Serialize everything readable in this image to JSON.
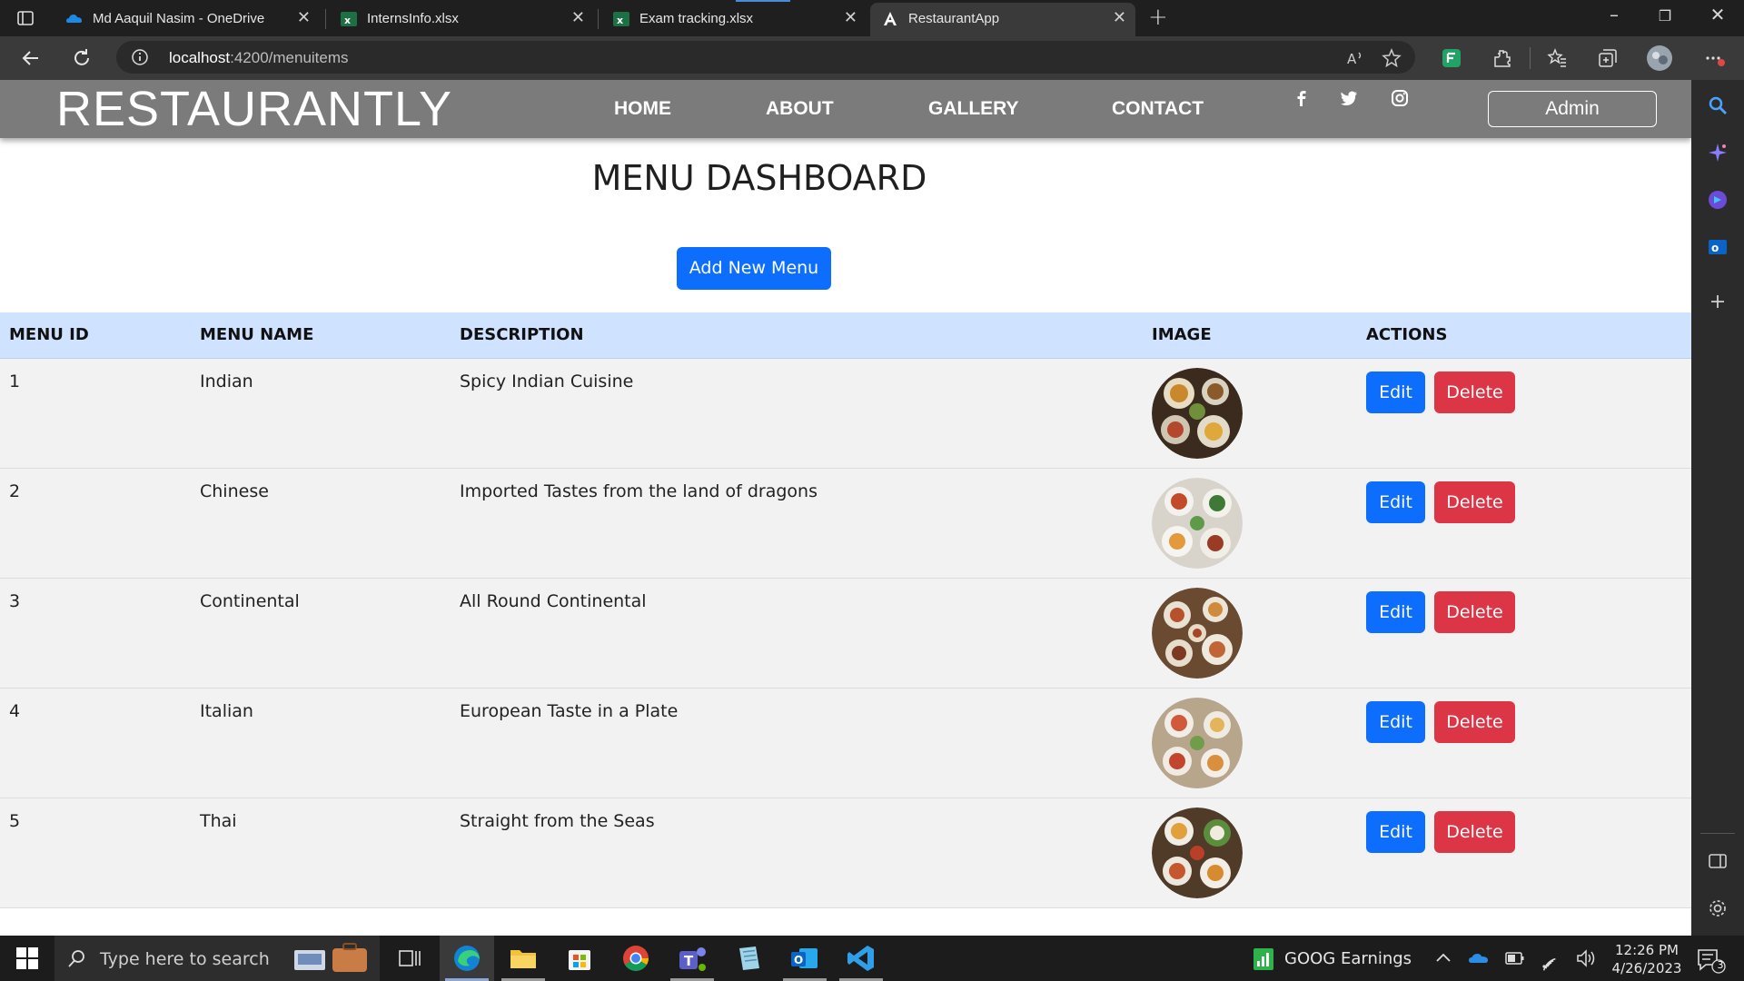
{
  "browser": {
    "tabs": [
      {
        "title": "Md Aaquil Nasim - OneDrive",
        "icon": "onedrive-icon"
      },
      {
        "title": "InternsInfo.xlsx",
        "icon": "excel-icon"
      },
      {
        "title": "Exam tracking.xlsx",
        "icon": "excel-icon"
      },
      {
        "title": "RestaurantApp",
        "icon": "angular-icon"
      }
    ],
    "url_host": "localhost",
    "url_path": ":4200/menuitems"
  },
  "site": {
    "brand": "RESTAURANTLY",
    "nav": [
      "HOME",
      "ABOUT",
      "GALLERY",
      "CONTACT"
    ],
    "social_icons": [
      "facebook-icon",
      "twitter-icon",
      "instagram-icon"
    ],
    "admin_label": "Admin"
  },
  "dashboard": {
    "title": "MENU DASHBOARD",
    "add_button": "Add New Menu",
    "columns": [
      "MENU ID",
      "MENU NAME",
      "DESCRIPTION",
      "IMAGE",
      "ACTIONS"
    ],
    "edit_label": "Edit",
    "delete_label": "Delete",
    "rows": [
      {
        "id": "1",
        "name": "Indian",
        "description": "Spicy Indian Cuisine"
      },
      {
        "id": "2",
        "name": "Chinese",
        "description": "Imported Tastes from the land of dragons"
      },
      {
        "id": "3",
        "name": "Continental",
        "description": "All Round Continental"
      },
      {
        "id": "4",
        "name": "Italian",
        "description": "European Taste in a Plate"
      },
      {
        "id": "5",
        "name": "Thai",
        "description": "Straight from the Seas"
      }
    ]
  },
  "taskbar": {
    "search_placeholder": "Type here to search",
    "ticker": "GOOG  Earnings",
    "time": "12:26 PM",
    "date": "4/26/2023",
    "notifications": "3"
  },
  "colors": {
    "primary": "#0d6efd",
    "danger": "#dc3545",
    "navbar": "#7b7b7b",
    "table_header": "#cfe2ff"
  }
}
